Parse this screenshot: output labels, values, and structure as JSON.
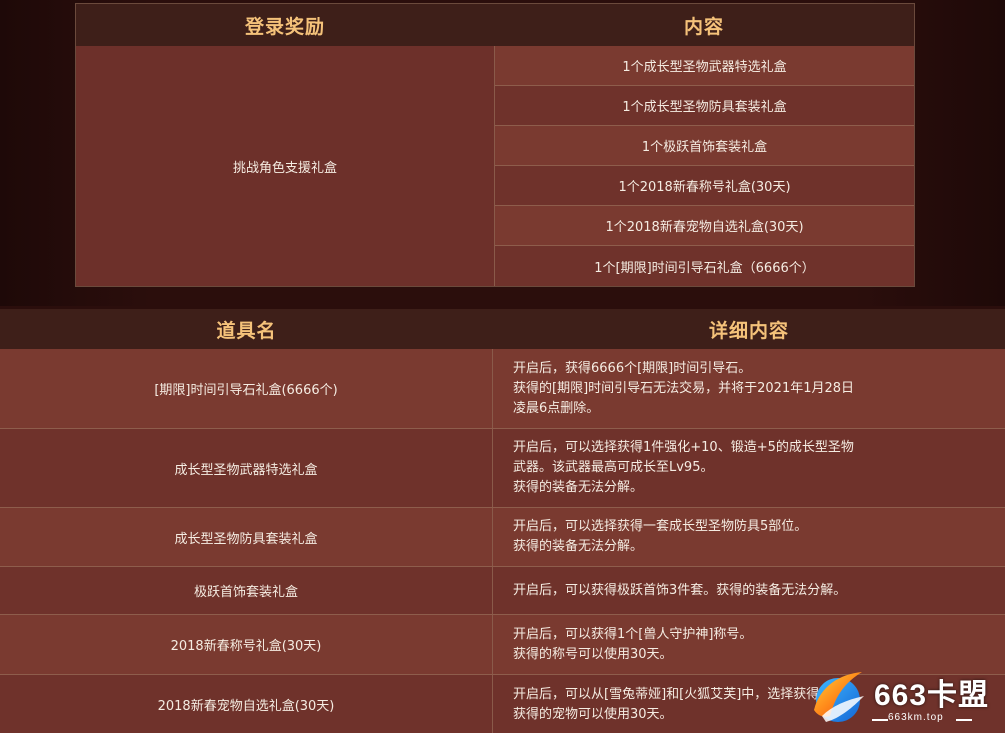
{
  "login_table": {
    "header_reward": "登录奖励",
    "header_content": "内容",
    "reward_name": "挑战角色支援礼盒",
    "items": [
      "1个成长型圣物武器特选礼盒",
      "1个成长型圣物防具套装礼盒",
      "1个极跃首饰套装礼盒",
      "1个2018新春称号礼盒(30天)",
      "1个2018新春宠物自选礼盒(30天)",
      "1个[期限]时间引导石礼盒（6666个）"
    ]
  },
  "item_table": {
    "header_name": "道具名",
    "header_detail": "详细内容",
    "rows": [
      {
        "name": "[期限]时间引导石礼盒(6666个)",
        "detail": [
          "开启后，获得6666个[期限]时间引导石。",
          "获得的[期限]时间引导石无法交易，并将于2021年1月28日",
          "凌晨6点删除。"
        ]
      },
      {
        "name": "成长型圣物武器特选礼盒",
        "detail": [
          "开启后，可以选择获得1件强化+10、锻造+5的成长型圣物",
          "武器。该武器最高可成长至Lv95。",
          "获得的装备无法分解。"
        ]
      },
      {
        "name": "成长型圣物防具套装礼盒",
        "detail": [
          "开启后，可以选择获得一套成长型圣物防具5部位。",
          "获得的装备无法分解。"
        ]
      },
      {
        "name": "极跃首饰套装礼盒",
        "detail": [
          "开启后，可以获得极跃首饰3件套。获得的装备无法分解。"
        ]
      },
      {
        "name": "2018新春称号礼盒(30天)",
        "detail": [
          "开启后，可以获得1个[兽人守护神]称号。",
          "获得的称号可以使用30天。"
        ]
      },
      {
        "name": "2018新春宠物自选礼盒(30天)",
        "detail": [
          "开启后，可以从[雪兔蒂娅]和[火狐艾芙]中，选择获得1个宠",
          "获得的宠物可以使用30天。"
        ]
      }
    ]
  },
  "watermark": {
    "brand": "663卡盟",
    "url": "663km.top",
    "logo_icon": "flame-globe-logo"
  },
  "colors": {
    "header_text": "#f5c27a",
    "header_bg": "#3e1f19",
    "row_a": "#7a3a30",
    "row_b": "#6f322b"
  }
}
